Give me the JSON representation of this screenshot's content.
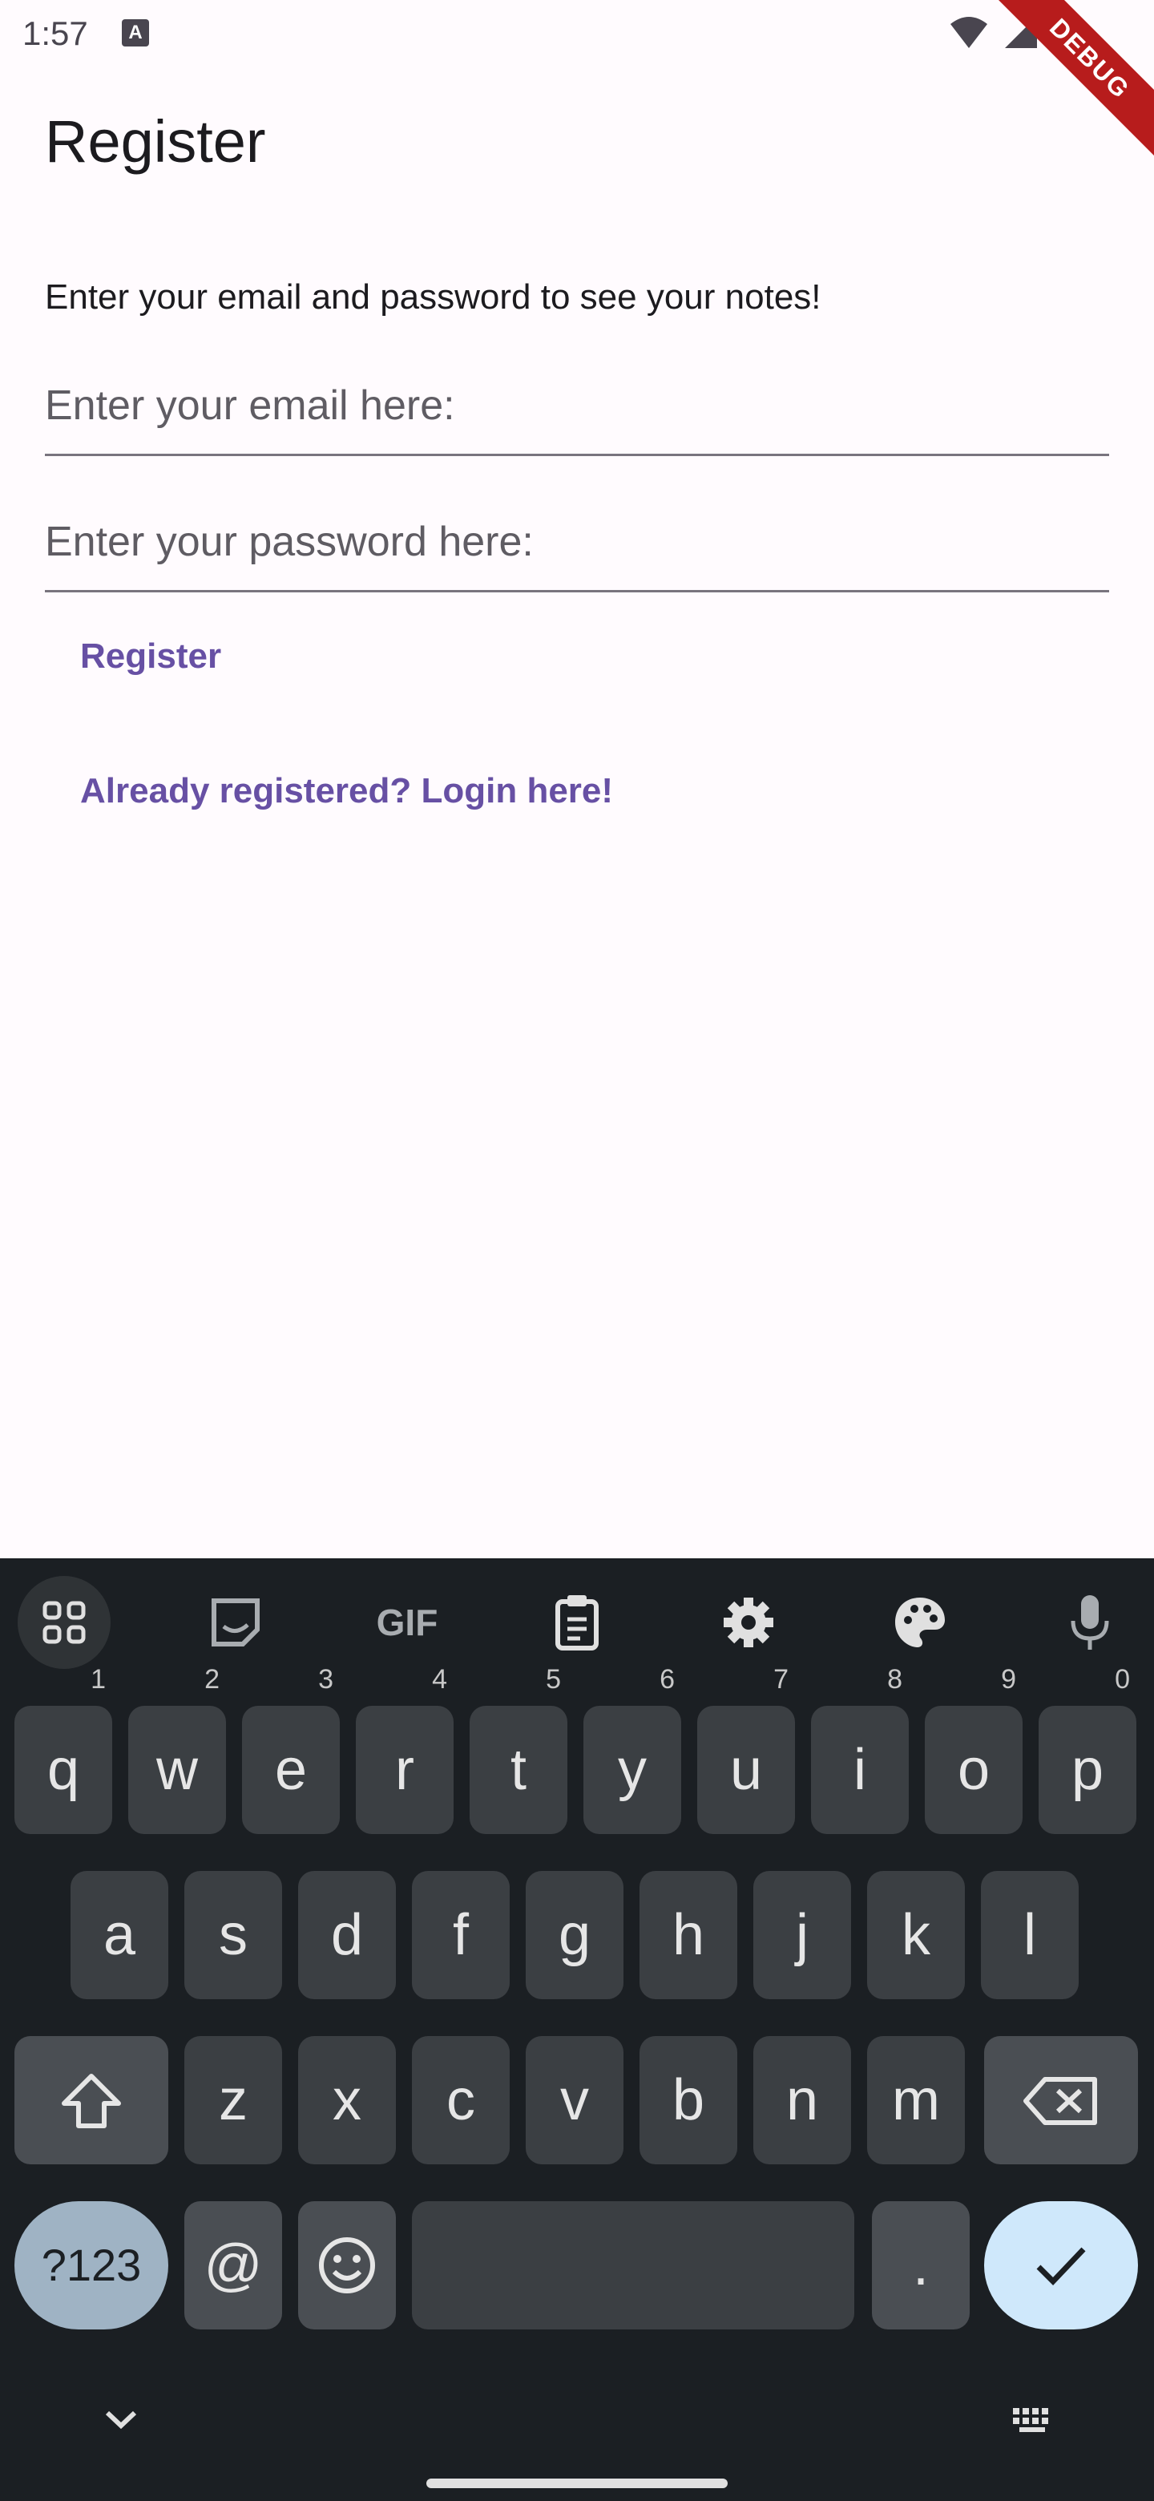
{
  "status_bar": {
    "time": "1:57",
    "a_label": "A",
    "debug_banner": "DEBUG"
  },
  "app_bar": {
    "title": "Register"
  },
  "content": {
    "intro": "Enter your email and password to see your notes!",
    "email_placeholder": "Enter your email here:",
    "password_placeholder": "Enter your password here:",
    "register_label": "Register",
    "login_label": "Already registered? Login here!"
  },
  "keyboard": {
    "toolbar": [
      "apps-icon",
      "sticker-icon",
      "gif-icon",
      "clipboard-icon",
      "settings-icon",
      "palette-icon",
      "mic-icon"
    ],
    "gif_label": "GIF",
    "row1": [
      {
        "k": "q",
        "h": "1"
      },
      {
        "k": "w",
        "h": "2"
      },
      {
        "k": "e",
        "h": "3"
      },
      {
        "k": "r",
        "h": "4"
      },
      {
        "k": "t",
        "h": "5"
      },
      {
        "k": "y",
        "h": "6"
      },
      {
        "k": "u",
        "h": "7"
      },
      {
        "k": "i",
        "h": "8"
      },
      {
        "k": "o",
        "h": "9"
      },
      {
        "k": "p",
        "h": "0"
      }
    ],
    "row2": [
      "a",
      "s",
      "d",
      "f",
      "g",
      "h",
      "j",
      "k",
      "l"
    ],
    "row3": [
      "z",
      "x",
      "c",
      "v",
      "b",
      "n",
      "m"
    ],
    "sym_label": "?123",
    "at_label": "@",
    "period_label": ".",
    "colors": {
      "bg": "#1b1f23",
      "key": "#3b3f43",
      "accent": "#6750a4",
      "enter": "#cfe8fb"
    }
  }
}
